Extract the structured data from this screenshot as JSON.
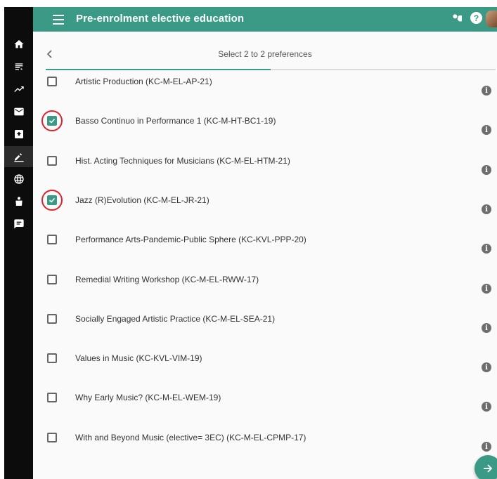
{
  "header": {
    "title": "Pre-enrolment elective education",
    "icons": [
      "menu-icon",
      "search-icon",
      "help-icon",
      "avatar"
    ],
    "help_glyph": "?"
  },
  "rail": {
    "items": [
      "home-icon",
      "list-icon",
      "trending-icon",
      "mail-icon",
      "inbox-icon",
      "edit-icon",
      "globe-icon",
      "cases-icon",
      "feedback-icon"
    ],
    "active_index": 5
  },
  "panel": {
    "subtitle": "Select 2 to 2 preferences",
    "progress_fraction": 0.5
  },
  "options": [
    {
      "label": "Artistic Production (KC-M-EL-AP-21)",
      "checked": false
    },
    {
      "label": "Basso Continuo in Performance 1 (KC-M-HT-BC1-19)",
      "checked": true
    },
    {
      "label": "Hist. Acting Techniques for Musicians (KC-M-EL-HTM-21)",
      "checked": false
    },
    {
      "label": "Jazz (R)Evolution (KC-M-EL-JR-21)",
      "checked": true
    },
    {
      "label": "Performance Arts-Pandemic-Public Sphere (KC-KVL-PPP-20)",
      "checked": false
    },
    {
      "label": "Remedial Writing Workshop (KC-M-EL-RWW-17)",
      "checked": false
    },
    {
      "label": "Socially Engaged Artistic Practice (KC-M-EL-SEA-21)",
      "checked": false
    },
    {
      "label": "Values in Music (KC-KVL-VIM-19)",
      "checked": false
    },
    {
      "label": "Why Early Music? (KC-M-EL-WEM-19)",
      "checked": false
    },
    {
      "label": "With and Beyond Music (elective= 3EC) (KC-M-EL-CPMP-17)",
      "checked": false
    }
  ],
  "info_glyph": "i",
  "colors": {
    "accent": "#3a9a86",
    "highlight": "#e0212b",
    "rail": "#0c0c0c"
  }
}
